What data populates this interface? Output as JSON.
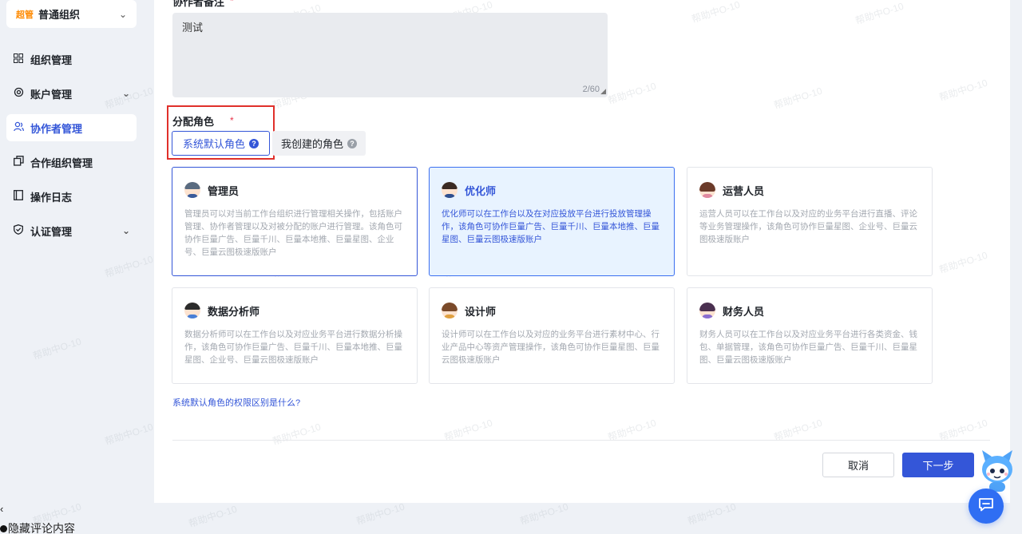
{
  "sidebar": {
    "org_badge": "超管",
    "org_name": "普通组织",
    "items": [
      {
        "label": "组织管理"
      },
      {
        "label": "账户管理"
      },
      {
        "label": "协作者管理"
      },
      {
        "label": "合作组织管理"
      },
      {
        "label": "操作日志"
      },
      {
        "label": "认证管理"
      }
    ]
  },
  "footer": {
    "collapse_glyph": "‹",
    "hide_comments": "隐藏评论内容"
  },
  "form": {
    "remark_label": "协作者备注",
    "required_mark": "*",
    "remark_value": "测试",
    "remark_counter": "2/60",
    "assign_label": "分配角色",
    "tab_system": "系统默认角色",
    "tab_mine": "我创建的角色",
    "help_glyph": "?"
  },
  "roles": [
    {
      "title": "管理员",
      "desc": "管理员可以对当前工作台组织进行管理相关操作，包括账户管理、协作者管理以及对被分配的账户进行管理。该角色可协作巨量广告、巨量千川、巨量本地推、巨量星图、企业号、巨量云图极速版账户"
    },
    {
      "title": "优化师",
      "desc": "优化师可以在工作台以及在对应投放平台进行投放管理操作，该角色可协作巨量广告、巨量千川、巨量本地推、巨量星图、巨量云图极速版账户"
    },
    {
      "title": "运营人员",
      "desc": "运营人员可以在工作台以及对应的业务平台进行直播、评论等业务管理操作，该角色可协作巨量星图、企业号、巨量云图极速版账户"
    },
    {
      "title": "数据分析师",
      "desc": "数据分析师可以在工作台以及对应业务平台进行数据分析操作，该角色可协作巨量广告、巨量千川、巨量本地推、巨量星图、企业号、巨量云图极速版账户"
    },
    {
      "title": "设计师",
      "desc": "设计师可以在工作台以及对应的业务平台进行素材中心、行业产品中心等资产管理操作，该角色可协作巨量星图、巨量云图极速版账户"
    },
    {
      "title": "财务人员",
      "desc": "财务人员可以在工作台以及对应业务平台进行各类资金、钱包、单据管理，该角色可协作巨量广告、巨量千川、巨量星图、巨量云图极速版账户"
    }
  ],
  "link_diff": "系统默认角色的权限区别是什么?",
  "actions": {
    "cancel": "取消",
    "next": "下一步"
  },
  "watermark": "帮助中O-10",
  "colors": {
    "accent": "#3456d8",
    "highlight": "#e0302b",
    "selected_fill": "#e8f3ff"
  }
}
